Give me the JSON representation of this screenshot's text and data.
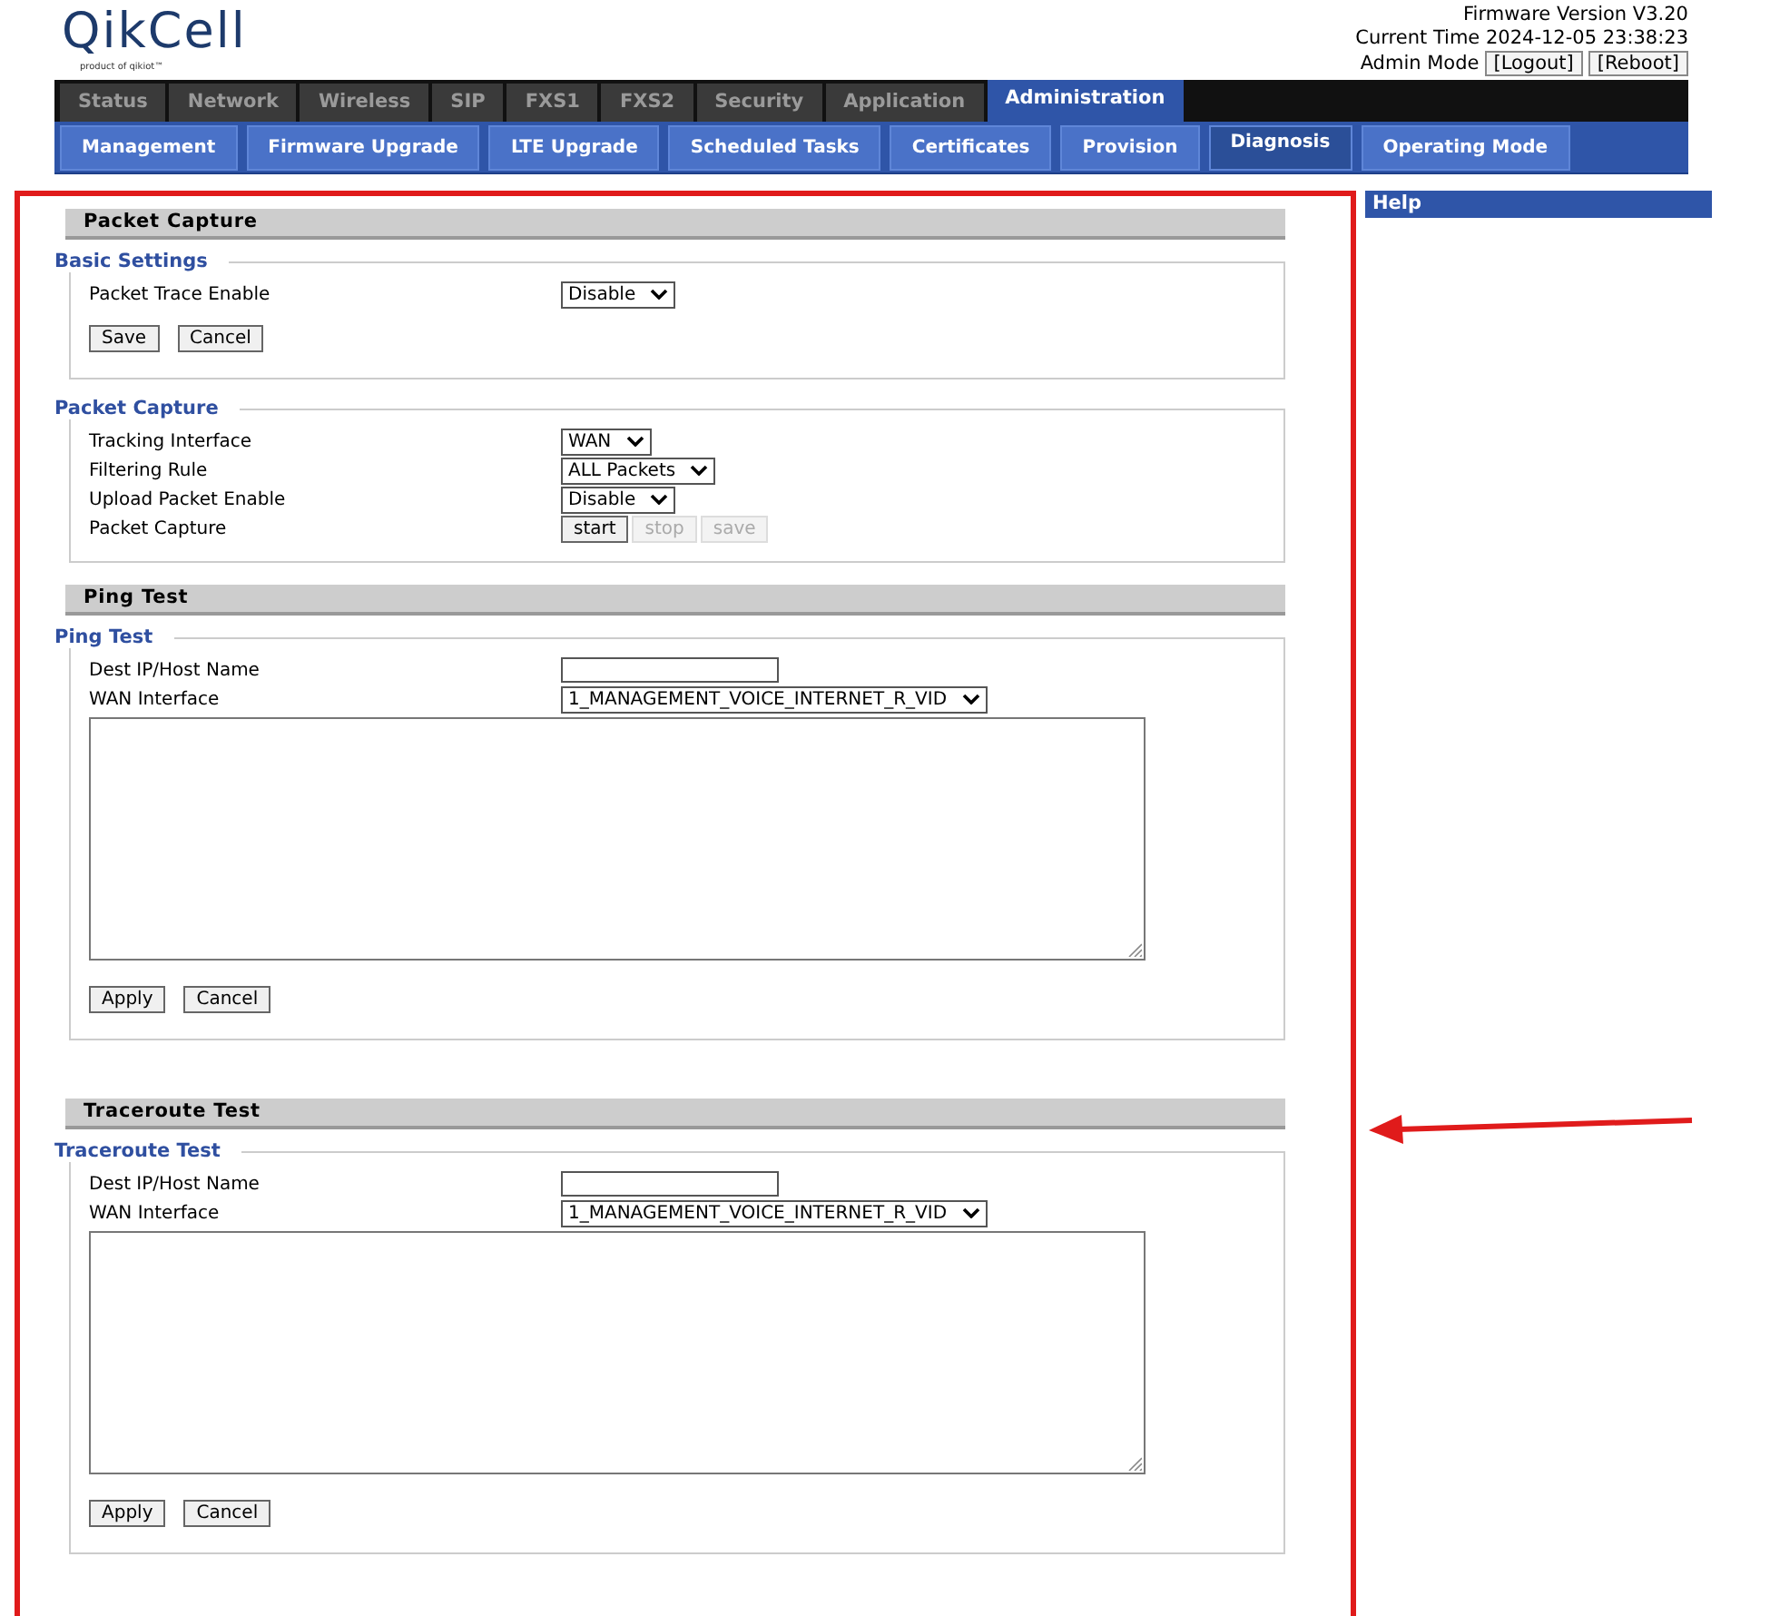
{
  "header": {
    "logo": "QikCell",
    "tagline": "product of qikiot™",
    "firmware": "Firmware Version V3.20",
    "time": "Current Time 2024-12-05 23:38:23",
    "mode": "Admin Mode",
    "buttons": [
      "[Logout]",
      "[Reboot]"
    ]
  },
  "main_tabs": [
    {
      "label": "Status",
      "selected": false
    },
    {
      "label": "Network",
      "selected": false
    },
    {
      "label": "Wireless",
      "selected": false
    },
    {
      "label": "SIP",
      "selected": false
    },
    {
      "label": "FXS1",
      "selected": false
    },
    {
      "label": "FXS2",
      "selected": false
    },
    {
      "label": "Security",
      "selected": false
    },
    {
      "label": "Application",
      "selected": false
    },
    {
      "label": "Administration",
      "selected": true
    }
  ],
  "sub_tabs": [
    {
      "label": "Management",
      "selected": false
    },
    {
      "label": "Firmware Upgrade",
      "selected": false
    },
    {
      "label": "LTE Upgrade",
      "selected": false
    },
    {
      "label": "Scheduled Tasks",
      "selected": false
    },
    {
      "label": "Certificates",
      "selected": false
    },
    {
      "label": "Provision",
      "selected": false
    },
    {
      "label": "Diagnosis",
      "selected": true
    },
    {
      "label": "Operating Mode",
      "selected": false
    }
  ],
  "sections": [
    {
      "title": "Packet Capture",
      "fieldsets": [
        {
          "legend": "Basic Settings",
          "rows": [
            {
              "kind": "select",
              "label": "Packet Trace Enable",
              "value": "Disable"
            }
          ],
          "buttons": [
            {
              "label": "Save",
              "disabled": false
            },
            {
              "label": "Cancel",
              "disabled": false
            }
          ]
        },
        {
          "legend": "Packet Capture",
          "rows": [
            {
              "kind": "select",
              "label": "Tracking Interface",
              "value": "WAN"
            },
            {
              "kind": "select",
              "label": "Filtering Rule",
              "value": "ALL Packets"
            },
            {
              "kind": "select",
              "label": "Upload Packet Enable",
              "value": "Disable"
            },
            {
              "kind": "buttons",
              "label": "Packet Capture",
              "buttons": [
                {
                  "label": "start",
                  "disabled": false
                },
                {
                  "label": "stop",
                  "disabled": true
                },
                {
                  "label": "save",
                  "disabled": true
                }
              ]
            }
          ]
        }
      ]
    },
    {
      "title": "Ping Test",
      "fieldsets": [
        {
          "legend": "Ping Test",
          "rows": [
            {
              "kind": "input",
              "label": "Dest IP/Host Name"
            },
            {
              "kind": "select",
              "label": "WAN Interface",
              "value": "1_MANAGEMENT_VOICE_INTERNET_R_VID"
            },
            {
              "kind": "textarea"
            }
          ],
          "buttons": [
            {
              "label": "Apply",
              "disabled": false
            },
            {
              "label": "Cancel",
              "disabled": false
            }
          ]
        }
      ]
    },
    {
      "title": "Traceroute Test",
      "fieldsets": [
        {
          "legend": "Traceroute Test",
          "rows": [
            {
              "kind": "input",
              "label": "Dest IP/Host Name"
            },
            {
              "kind": "select",
              "label": "WAN Interface",
              "value": "1_MANAGEMENT_VOICE_INTERNET_R_VID"
            },
            {
              "kind": "textarea"
            }
          ],
          "buttons": [
            {
              "label": "Apply",
              "disabled": false
            },
            {
              "label": "Cancel",
              "disabled": false
            }
          ]
        }
      ]
    }
  ],
  "help": {
    "title": "Help"
  }
}
